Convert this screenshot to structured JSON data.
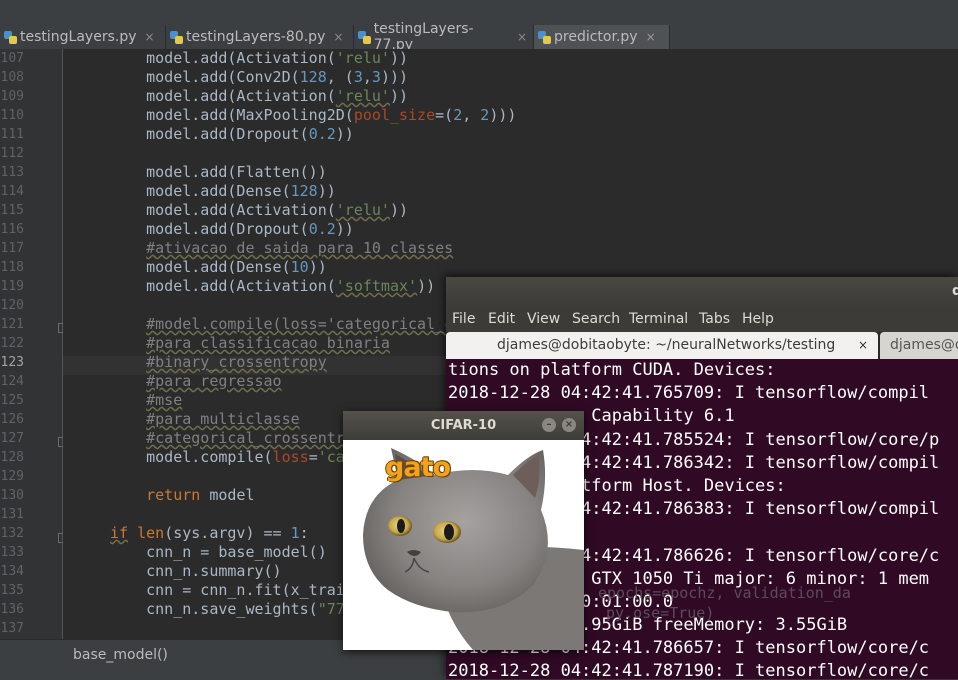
{
  "ide": {
    "tabs": [
      {
        "label": "testingLayers.py",
        "close": "×"
      },
      {
        "label": "testingLayers-80.py",
        "close": "×"
      },
      {
        "label": "testingLayers-77.py",
        "close": "×"
      },
      {
        "label": "predictor.py",
        "close": "×"
      }
    ],
    "active_tab": "predictor.py",
    "line_numbers": [
      "107",
      "108",
      "109",
      "110",
      "111",
      "112",
      "113",
      "114",
      "115",
      "116",
      "117",
      "118",
      "119",
      "120",
      "121",
      "122",
      "123",
      "124",
      "125",
      "126",
      "127",
      "128",
      "129",
      "130",
      "131",
      "132",
      "133",
      "134",
      "135",
      "136",
      "137"
    ],
    "code": {
      "l107_a": "    model.add(Activation(",
      "l107_s": "'relu'",
      "l107_b": "))",
      "l108_a": "    model.add(Conv2D(",
      "l108_n1": "128",
      "l108_b": ", (",
      "l108_n2": "3",
      "l108_c": ",",
      "l108_n3": "3",
      "l108_d": ")))",
      "l109_a": "    model.add(Activation(",
      "l109_s": "'relu'",
      "l109_b": "))",
      "l110_a": "    model.add(MaxPooling2D(",
      "l110_k": "pool_size",
      "l110_b": "=(",
      "l110_n1": "2",
      "l110_c": ", ",
      "l110_n2": "2",
      "l110_d": ")))",
      "l111_a": "    model.add(Dropout(",
      "l111_n": "0.2",
      "l111_b": "))",
      "l113": "    model.add(Flatten())",
      "l114_a": "    model.add(Dense(",
      "l114_n": "128",
      "l114_b": "))",
      "l115_a": "    model.add(Activation(",
      "l115_s": "'relu'",
      "l115_b": "))",
      "l116_a": "    model.add(Dropout(",
      "l116_n": "0.2",
      "l116_b": "))",
      "l117_i": "    ",
      "l117_c": "#ativacao de saida para 10 classes",
      "l118_a": "    model.add(Dense(",
      "l118_n": "10",
      "l118_b": "))",
      "l119_a": "    model.add(Activation(",
      "l119_s": "'softmax'",
      "l119_b": "))",
      "l121_i": "    ",
      "l121_c": "#model.compile(loss='categorical_c",
      "l122_i": "    ",
      "l122_c": "#para classificacao binaria",
      "l123_i": "    ",
      "l123_c": "#binary_crossentropy",
      "l124_i": "    ",
      "l124_c": "#para regressao",
      "l125_i": "    ",
      "l125_c": "#mse",
      "l126_i": "    ",
      "l126_c": "#para multiclasse",
      "l127_i": "    ",
      "l127_c": "#categorical_crossentro",
      "l128_a": "    model.compile(",
      "l128_k": "loss",
      "l128_b": "=",
      "l128_s": "'cate",
      "l130_i": "    ",
      "l130_k": "return",
      "l130_b": " model",
      "l132_k": "if",
      "l132_sp": " ",
      "l132_f": "len",
      "l132_a": "(sys.argv) == ",
      "l132_n": "1",
      "l132_b": ":",
      "l133": "    cnn_n = base_model()",
      "l134": "    cnn_n.summary()",
      "l135": "    cnn = cnn_n.fit(x_train",
      "l136_a": "    cnn_n.save_weights(",
      "l136_s": "\"77-i"
    },
    "breadcrumb": "base_model()"
  },
  "terminal": {
    "title": "d",
    "menu": [
      "File",
      "Edit",
      "View",
      "Search",
      "Terminal",
      "Tabs",
      "Help"
    ],
    "tab_active": "djames@dobitaobyte: ~/neuralNetworks/testing",
    "tab_close": "×",
    "tab_other": "djames@d",
    "lines": [
      "tions on platform CUDA. Devices:",
      "2018-12-28 04:42:41.765709: I tensorflow/compil",
      "            e Capability 6.1",
      "            04:42:41.785524: I tensorflow/core/p",
      "            04:42:41.786342: I tensorflow/compil",
      "            atform Host. Devices:",
      "            04:42:41.786383: I tensorflow/compil",
      "",
      "            04:42:41.786626: I tensorflow/core/c",
      "            e GTX 1050 Ti major: 6 minor: 1 mem",
      "            00:01:00.0",
      "            3.95GiB freeMemory: 3.55GiB",
      "2018-12-28 04:42:41.786657: I tensorflow/core/c",
      "2018-12-28 04:42:41.787190: I tensorflow/core/c"
    ],
    "faint_1": "epochs=epochz, validation_da",
    "faint_2": "py.ose=True)"
  },
  "cifar": {
    "title": "CIFAR-10",
    "btn_min": "–",
    "btn_close": "×",
    "prediction": "gato"
  }
}
